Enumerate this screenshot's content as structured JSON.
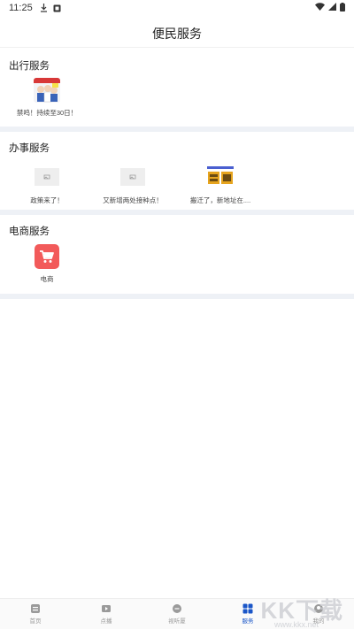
{
  "status_bar": {
    "time": "11:25"
  },
  "header": {
    "title": "便民服务"
  },
  "sections": [
    {
      "title": "出行服务",
      "items": [
        {
          "label": "禁鸣！持续至30日！"
        }
      ]
    },
    {
      "title": "办事服务",
      "items": [
        {
          "label": "政策来了！"
        },
        {
          "label": "又新增两处接种点！"
        },
        {
          "label": "搬迁了，新地址在...."
        }
      ]
    },
    {
      "title": "电商服务",
      "items": [
        {
          "label": "电商",
          "icon": "shopping-cart-icon",
          "color": "#f25a5a"
        }
      ]
    }
  ],
  "tabbar": {
    "items": [
      {
        "label": "首页",
        "icon": "home-doc-icon"
      },
      {
        "label": "点播",
        "icon": "video-play-icon"
      },
      {
        "label": "视听厦",
        "icon": "chat-bubble-icon"
      },
      {
        "label": "服务",
        "icon": "grid-icon",
        "active": true
      },
      {
        "label": "我的",
        "icon": "user-icon"
      }
    ],
    "active_color": "#1a56c8"
  },
  "watermark": {
    "text": "KK下载",
    "url": "www.kkx.net"
  }
}
